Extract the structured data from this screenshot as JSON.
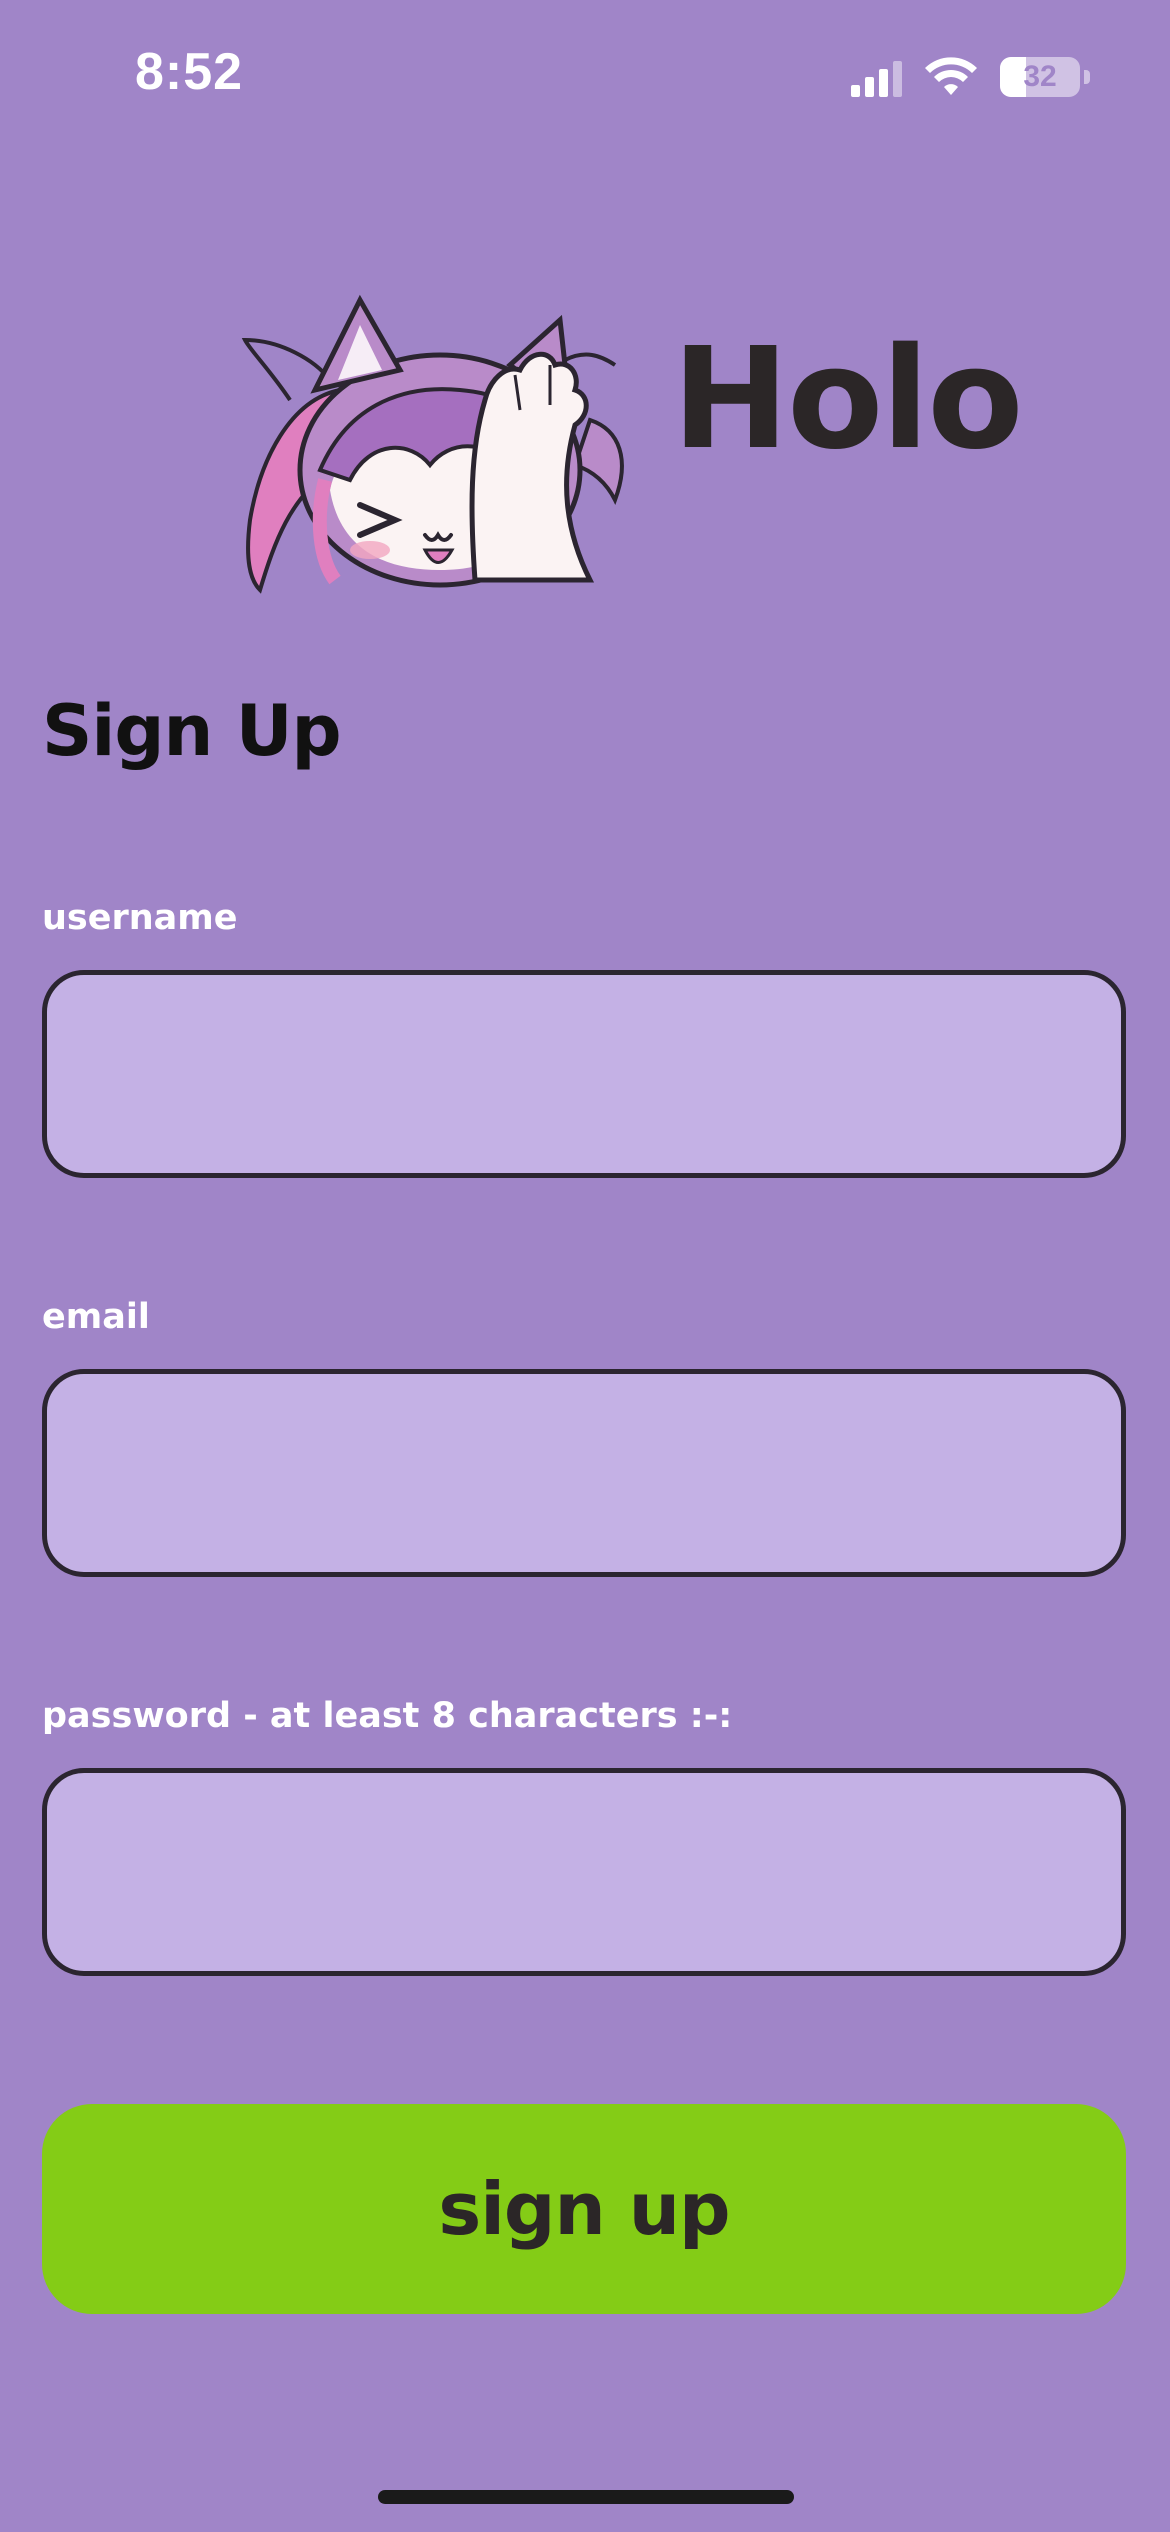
{
  "status_bar": {
    "time": "8:52",
    "battery_level": "32",
    "icons": [
      "signal-icon",
      "wifi-icon",
      "battery-icon"
    ]
  },
  "header": {
    "app_name": "Holo",
    "mascot": "cat-girl-mascot"
  },
  "form": {
    "title": "Sign Up",
    "fields": [
      {
        "label": "username",
        "value": "",
        "placeholder": ""
      },
      {
        "label": "email",
        "value": "",
        "placeholder": ""
      },
      {
        "label": "password - at least 8 characters :-:",
        "value": "",
        "placeholder": ""
      }
    ],
    "submit_label": "sign up"
  },
  "colors": {
    "background": "#a085c8",
    "input_fill": "#c4b1e5",
    "input_border": "#2b2530",
    "button": "#84cc16",
    "text_dark": "#2b2627",
    "label_text": "#ffffff"
  }
}
